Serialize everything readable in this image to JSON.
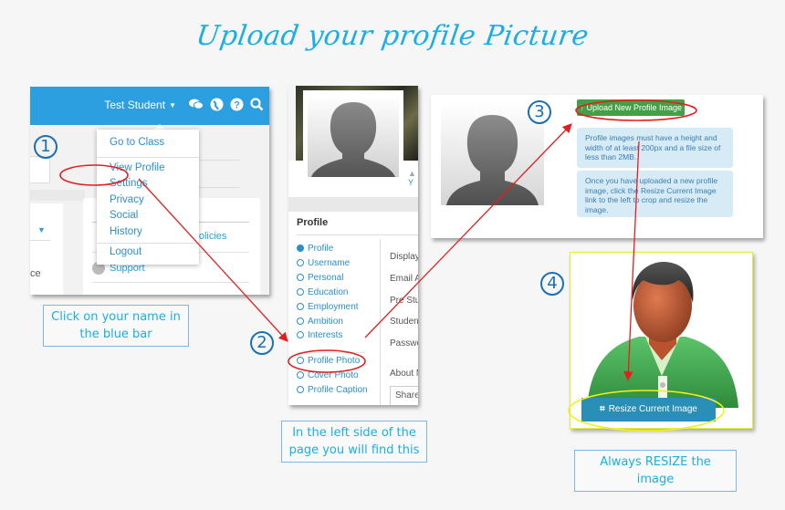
{
  "title": "Upload your profile Picture",
  "steps": [
    "1",
    "2",
    "3",
    "4"
  ],
  "panel1": {
    "username": "Test Student",
    "topbar_icons": [
      "chat-icon",
      "globe-icon",
      "help-icon",
      "search-icon"
    ],
    "topbar_glyphs": [
      "💬",
      "●",
      "?",
      "⚲"
    ],
    "menu_items": [
      "Go to Class",
      "View Profile",
      "Settings",
      "Privacy",
      "Social",
      "History",
      "Logout"
    ],
    "background_link_1": "General Policies",
    "background_link_1_visible": "neral Policies",
    "background_link_2": "Support",
    "background_partial_text": "ce",
    "highlighted_item": "Settings"
  },
  "panel2": {
    "section_title": "Profile",
    "nav_items": [
      "Profile",
      "Username",
      "Personal",
      "Education",
      "Employment",
      "Ambition",
      "Interests"
    ],
    "nav_items_2": [
      "Profile Photo",
      "Cover Photo",
      "Profile Caption"
    ],
    "active_item": "Profile",
    "highlighted_item": "Profile Photo",
    "field_labels": [
      "Display",
      "Email A",
      "Pre Stu",
      "Student",
      "Passwo",
      "About M"
    ],
    "share_button": "Share",
    "user_link_partial": "Y"
  },
  "panel3": {
    "upload_button": "Upload New Profile Image",
    "upload_icon": "↑",
    "info_1": "Profile images must have a height and width of at least 200px and a file size of less than 2MB.",
    "info_2": "Once you have uploaded a new profile image, click the Resize Current Image link to the left to crop and resize the image."
  },
  "panel4": {
    "resize_button": "Resize Current Image",
    "resize_icon": "⌗"
  },
  "captions": {
    "step1": "Click on your name in the blue bar",
    "step2": "In the left side of the page you will find this",
    "step4": "Always RESIZE the image"
  },
  "colors": {
    "title": "#1aaee6",
    "topbar": "#2b9fe0",
    "upload_button": "#43a047",
    "resize_button": "#2a8fb6",
    "info_box": "#d7ebf7",
    "highlight_red": "#e02020",
    "highlight_yellow": "#f0f020",
    "step_circle": "#1a6fb5"
  }
}
